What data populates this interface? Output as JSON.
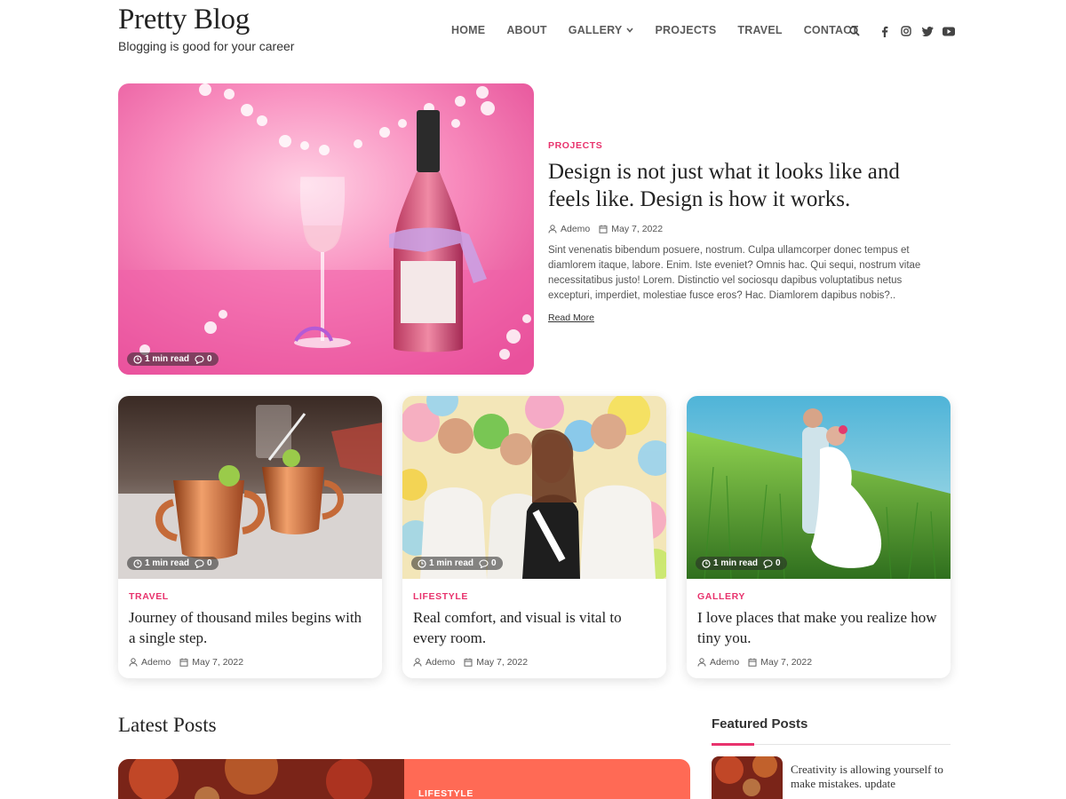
{
  "site": {
    "title": "Pretty Blog",
    "tagline": "Blogging is good for your career"
  },
  "nav": {
    "items": [
      {
        "label": "HOME"
      },
      {
        "label": "ABOUT"
      },
      {
        "label": "GALLERY",
        "has_dropdown": true
      },
      {
        "label": "PROJECTS"
      },
      {
        "label": "TRAVEL"
      },
      {
        "label": "CONTACT"
      }
    ],
    "icons": [
      "search-icon",
      "facebook-icon",
      "instagram-icon",
      "twitter-icon",
      "youtube-icon"
    ]
  },
  "hero": {
    "category": "PROJECTS",
    "title": "Design is not just what it looks like and feels like. Design is how it works.",
    "author": "Ademo",
    "date": "May 7, 2022",
    "excerpt": "Sint venenatis bibendum posuere, nostrum. Culpa ullamcorper donec tempus et diamlorem itaque, labore. Enim. Iste eveniet? Omnis hac. Qui sequi, nostrum vitae necessitatibus justo! Lorem. Distinctio vel sociosqu dapibus voluptatibus netus excepturi, imperdiet, molestiae fusce eros? Hac. Diamlorem dapibus nobis?..",
    "read_more": "Read More",
    "read_time": "1 min read",
    "comments": "0"
  },
  "cards": [
    {
      "category": "TRAVEL",
      "title": "Journey of thousand miles begins with a single step.",
      "author": "Ademo",
      "date": "May 7, 2022",
      "read_time": "1 min read",
      "comments": "0"
    },
    {
      "category": "LIFESTYLE",
      "title": "Real comfort, and visual is vital to every room.",
      "author": "Ademo",
      "date": "May 7, 2022",
      "read_time": "1 min read",
      "comments": "0"
    },
    {
      "category": "GALLERY",
      "title": "I love places that make you realize how tiny you.",
      "author": "Ademo",
      "date": "May 7, 2022",
      "read_time": "1 min read",
      "comments": "0"
    }
  ],
  "latest": {
    "heading": "Latest Posts",
    "first_category": "LIFESTYLE"
  },
  "featured": {
    "heading": "Featured Posts",
    "items": [
      {
        "title": "Creativity is allowing yourself to make mistakes. update"
      }
    ]
  },
  "colors": {
    "accent": "#e8336d",
    "latest_card_bg": "#ff6a55"
  }
}
